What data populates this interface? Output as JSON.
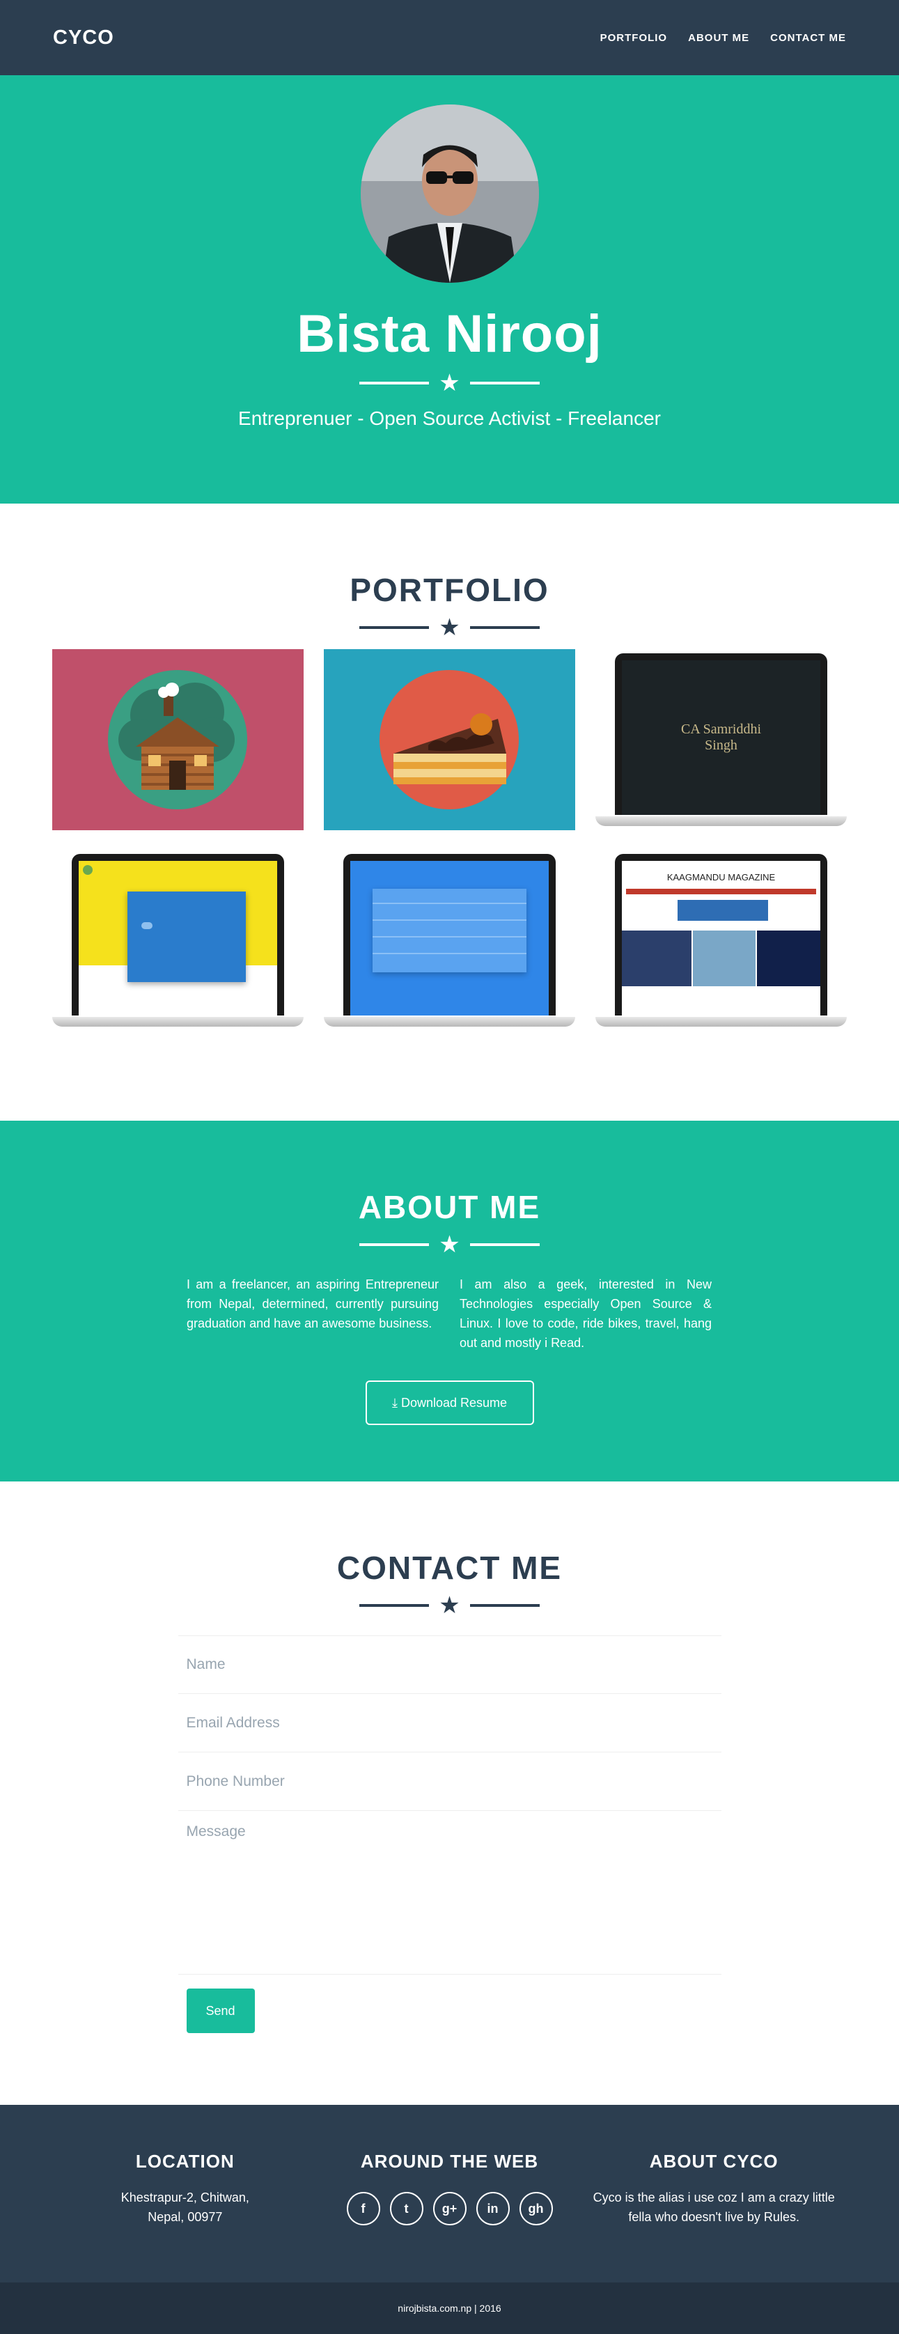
{
  "nav": {
    "brand": "CYCO",
    "links": [
      "Portfolio",
      "About Me",
      "Contact Me"
    ]
  },
  "hero": {
    "title": "Bista Nirooj",
    "subtitle": "Entreprenuer - Open Source Activist - Freelancer"
  },
  "portfolio": {
    "title": "Portfolio",
    "items": [
      {
        "style": "illustration",
        "icon": "cabin-icon",
        "bg": "#c0506a"
      },
      {
        "style": "illustration",
        "icon": "cake-icon",
        "bg": "#27a3bd"
      },
      {
        "style": "laptop",
        "screen_title": "CA Samriddhi",
        "screen_title2": "Singh"
      },
      {
        "style": "laptop",
        "screen": "yellow-site"
      },
      {
        "style": "laptop",
        "screen": "blue-table"
      },
      {
        "style": "laptop",
        "screen_title": "KAAGMANDU MAGAZINE"
      }
    ]
  },
  "about": {
    "title": "About Me",
    "col1": "I am a freelancer, an aspiring Entrepreneur from Nepal, determined, currently pursuing graduation and have an awesome business.",
    "col2": "I am also a geek, interested in New Technologies especially Open Source & Linux. I love to code, ride bikes, travel, hang out and mostly i Read.",
    "resume_label": "Download Resume"
  },
  "contact": {
    "title": "Contact Me",
    "name_placeholder": "Name",
    "email_placeholder": "Email Address",
    "phone_placeholder": "Phone Number",
    "message_placeholder": "Message",
    "send_label": "Send"
  },
  "footer": {
    "location_title": "Location",
    "location_line1": "Khestrapur-2, Chitwan,",
    "location_line2": "Nepal, 00977",
    "web_title": "Around the Web",
    "social": [
      "f",
      "t",
      "g+",
      "in",
      "gh"
    ],
    "about_title": "About CYCO",
    "about_text": "Cyco is the alias i use coz I am a crazy little fella who doesn't live by Rules.",
    "copyright": "nirojbista.com.np | 2016"
  },
  "colors": {
    "primary": "#2c3e50",
    "accent": "#18bc9c"
  }
}
